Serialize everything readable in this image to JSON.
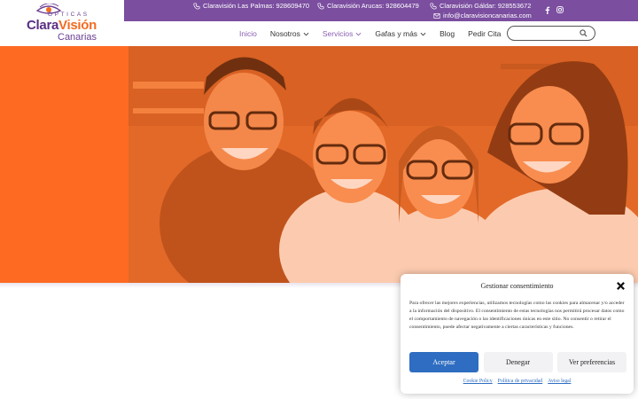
{
  "topbar": {
    "background": "#7b4ea0",
    "contacts": [
      {
        "icon": "phone-icon",
        "text": "Claravisión Las Palmas: 928609470"
      },
      {
        "icon": "phone-icon",
        "text": "Claravisión Arucas: 928604479"
      },
      {
        "icon": "phone-icon",
        "text": "Claravisión Gáldar: 928553672"
      },
      {
        "icon": "mail-icon",
        "text": "info@claravisioncanarias.com"
      }
    ],
    "social": [
      "facebook-icon",
      "instagram-icon"
    ]
  },
  "logo": {
    "opticas": "OPTICAS",
    "brand_a": "Clara",
    "brand_b": "Visión",
    "city": "Canarias"
  },
  "nav": {
    "items": [
      {
        "label": "Inicio",
        "state": "active",
        "dropdown": false
      },
      {
        "label": "Nosotros",
        "state": "normal",
        "dropdown": true
      },
      {
        "label": "Servicios",
        "state": "highlight",
        "dropdown": true
      },
      {
        "label": "Gafas y más",
        "state": "normal",
        "dropdown": true
      },
      {
        "label": "Blog",
        "state": "normal",
        "dropdown": false
      },
      {
        "label": "Pedir Cita",
        "state": "normal",
        "dropdown": false
      }
    ],
    "search_placeholder": ""
  },
  "colors": {
    "accent_orange": "#ff6a22",
    "purple": "#7b4ea0",
    "button_blue": "#2e6dc1"
  },
  "cookie": {
    "title": "Gestionar consentimiento",
    "body": "Para ofrecer las mejores experiencias, utilizamos tecnologías como las cookies para almacenar y/o acceder a la información del dispositivo. El consentimiento de estas tecnologías nos permitirá procesar datos como el comportamiento de navegación o las identificaciones únicas en este sitio. No consentir o retirar el consentimiento, puede afectar negativamente a ciertas características y funciones.",
    "accept": "Aceptar",
    "deny": "Denegar",
    "preferences": "Ver preferencias",
    "links": [
      "Cookie Policy",
      "Política de privacidad",
      "Aviso legal"
    ]
  }
}
